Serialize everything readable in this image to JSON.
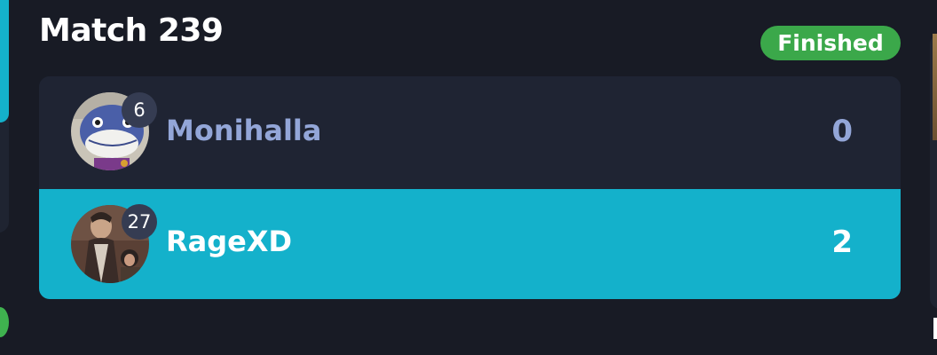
{
  "match": {
    "title": "Match 239",
    "status": "Finished",
    "status_color": "#3ba84a"
  },
  "players": [
    {
      "name": "Monihalla",
      "seed": "6",
      "score": "0",
      "winner": false,
      "avatar_icon": "shark-mascot-avatar"
    },
    {
      "name": "RageXD",
      "seed": "27",
      "score": "2",
      "winner": true,
      "avatar_icon": "painting-portrait-avatar"
    }
  ],
  "colors": {
    "background": "#181b25",
    "card": "#1f2433",
    "winner_row": "#14b1cb",
    "loser_text": "#93a6d8",
    "seed_badge": "#353c52"
  }
}
